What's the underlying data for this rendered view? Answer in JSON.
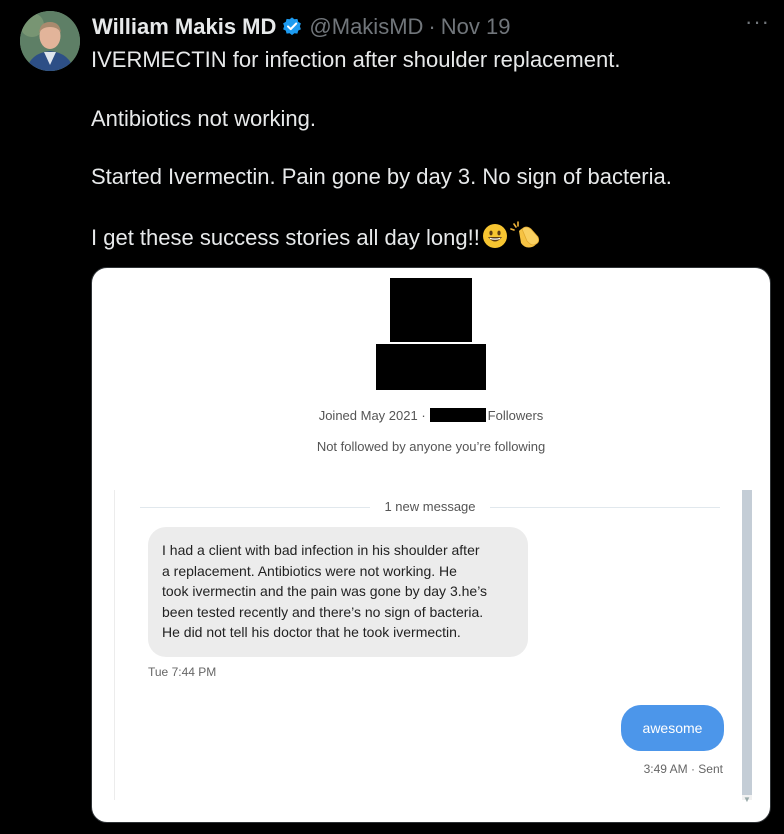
{
  "author": {
    "name": "William Makis MD",
    "handle": "@MakisMD",
    "separator": "·",
    "time": "Nov 19",
    "more_label": "···"
  },
  "tweet": {
    "lines": [
      "IVERMECTIN for infection after shoulder replacement.",
      "Antibiotics not working.",
      "Started Ivermectin. Pain gone by day 3. No sign of bacteria.",
      "I get these success stories all day long!!"
    ],
    "emojis": [
      "grinning-face",
      "clapping-hands"
    ]
  },
  "screenshot": {
    "joined": "Joined May 2021 ·",
    "followers_label": "Followers",
    "not_followed": "Not followed by anyone you’re following",
    "divider_label": "1 new message",
    "incoming_lines": [
      "I had a client with bad infection in his shoulder after",
      "a replacement. Antibiotics were not working. He",
      "took ivermectin and the pain was gone by day 3.he’s",
      "been tested recently and there’s no sign of bacteria.",
      "He did not tell his doctor that he took ivermectin."
    ],
    "incoming_time": "Tue 7:44 PM",
    "outgoing_text": "awesome",
    "outgoing_time": "3:49 AM · Sent"
  },
  "colors": {
    "background": "#000000",
    "verified_badge": "#1d9bf0",
    "muted_text": "#71767b",
    "outgoing_bubble": "#4c96ea",
    "incoming_bubble": "#ececec"
  }
}
